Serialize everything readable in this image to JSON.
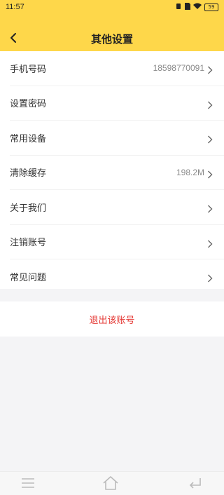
{
  "status_bar": {
    "time": "11:57",
    "battery": "59"
  },
  "header": {
    "title": "其他设置"
  },
  "settings": [
    {
      "label": "手机号码",
      "value": "18598770091"
    },
    {
      "label": "设置密码",
      "value": ""
    },
    {
      "label": "常用设备",
      "value": ""
    },
    {
      "label": "清除缓存",
      "value": "198.2M"
    },
    {
      "label": "关于我们",
      "value": ""
    },
    {
      "label": "注销账号",
      "value": ""
    },
    {
      "label": "常见问题",
      "value": ""
    }
  ],
  "logout": {
    "label": "退出该账号"
  },
  "colors": {
    "header_bg": "#fed74a",
    "logout_text": "#e53935",
    "page_bg": "#f4f4f6"
  },
  "icons": [
    "back-arrow",
    "chevron-right",
    "menu",
    "home",
    "back"
  ]
}
